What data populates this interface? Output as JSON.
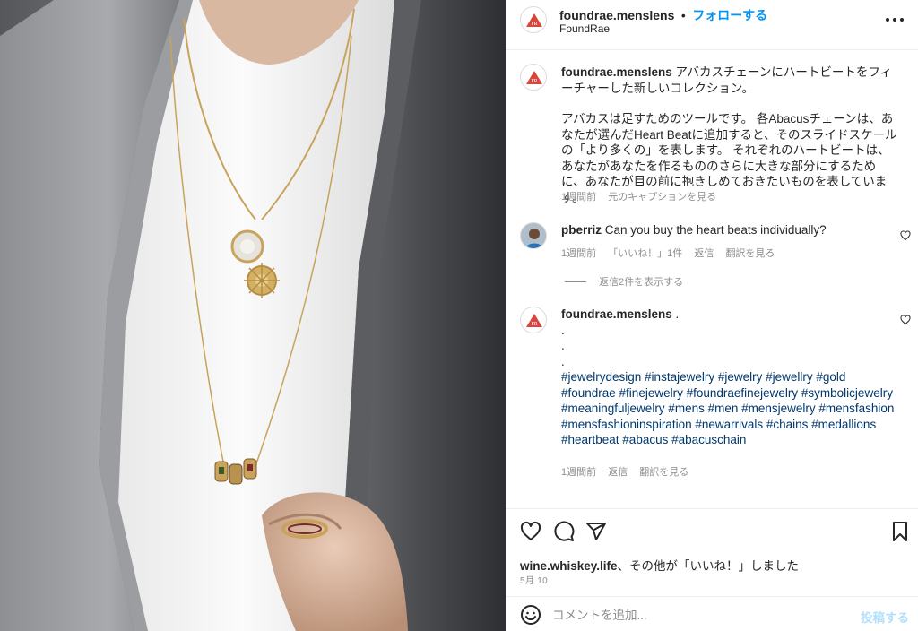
{
  "post": {
    "username": "foundrae.menslens",
    "dot": "•",
    "follow_label": "フォローする",
    "subtitle": "FoundRae",
    "more_icon": "more-horizontal-icon"
  },
  "caption": {
    "username": "foundrae.menslens",
    "line1": "アバカスチェーンにハートビートをフィーチャーした新しいコレクション。",
    "line2": "アバカスは足すためのツールです。 各Abacusチェーンは、あなたが選んだHeart Beatに追加すると、そのスライドスケールの「より多くの」を表します。 それぞれのハートビートは、あなたがあなたを作るもののさらに大きな部分にするために、あなたが目の前に抱きしめておきたいものを表しています。",
    "time": "1週間前",
    "see_translation": "元のキャプションを見る"
  },
  "comments": [
    {
      "username": "pberriz",
      "text": "Can you buy the heart beats individually?",
      "time": "1週間前",
      "likes": "「いいね！」1件",
      "reply": "返信",
      "translate": "翻訳を見る",
      "view_replies": "返信2件を表示する"
    },
    {
      "username": "foundrae.menslens",
      "text": ".",
      "dots": [
        ".",
        ".",
        "."
      ],
      "hashtags": "#jewelrydesign #instajewelry #jewelry #jewellry #gold #foundrae #finejewelry #foundraefinejewelry #symbolicjewelry #meaningfuljewelry #mens #men #mensjewelry #mensfashion #mensfashioninspiration #newarrivals #chains #medallions #heartbeat #abacus #abacuschain",
      "time": "1週間前",
      "reply": "返信",
      "translate": "翻訳を見る"
    }
  ],
  "actions": {
    "icons": [
      "heart-icon",
      "comment-icon",
      "share-icon",
      "bookmark-icon"
    ],
    "liked_by_user": "wine.whiskey.life",
    "liked_by_suffix": "、その他が「いいね！」しました",
    "date": "5月 10"
  },
  "composer": {
    "placeholder": "コメントを追加...",
    "post_label": "投稿する"
  },
  "colors": {
    "accent": "#0095f6",
    "post_disabled": "#b2dffc",
    "hashtag": "#00376b",
    "muted": "#8e8e8e",
    "brand_red": "#d9443c"
  }
}
